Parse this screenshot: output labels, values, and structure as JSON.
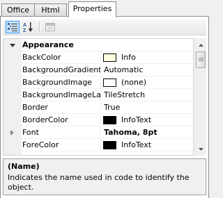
{
  "tabs": [
    {
      "label": "Office",
      "active": false
    },
    {
      "label": "Html",
      "active": false
    },
    {
      "label": "Properties",
      "active": true
    }
  ],
  "toolbar": {
    "categorized_icon": "categorized-list-icon",
    "alphabetical_icon": "sort-az-icon",
    "property_pages_icon": "property-pages-icon"
  },
  "grid": {
    "category": {
      "name": "Appearance",
      "expanded": true
    },
    "rows": [
      {
        "name": "BackColor",
        "value": "Info",
        "swatch": "#ffffe1"
      },
      {
        "name": "BackgroundGradient",
        "value": "Automatic"
      },
      {
        "name": "BackgroundImage",
        "value": "(none)",
        "swatch": "#ffffff"
      },
      {
        "name": "BackgroundImageLa",
        "value": "TileStretch"
      },
      {
        "name": "Border",
        "value": "True"
      },
      {
        "name": "BorderColor",
        "value": "InfoText",
        "swatch": "#000000"
      },
      {
        "name": "Font",
        "value": "Tahoma, 8pt",
        "bold": true,
        "expandable": true
      },
      {
        "name": "ForeColor",
        "value": "InfoText",
        "swatch": "#000000"
      }
    ]
  },
  "description": {
    "title": "(Name)",
    "text": "Indicates the name used in code to identify the object."
  },
  "colors": {
    "selection": "#cce4f7",
    "selection_border": "#3399ff",
    "border": "#898c95"
  }
}
